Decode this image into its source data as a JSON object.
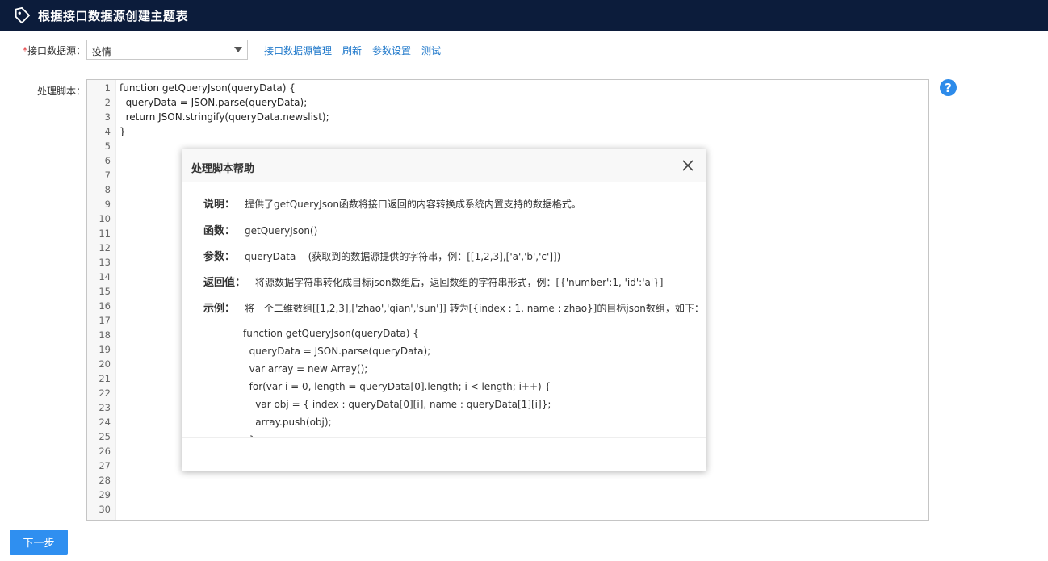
{
  "header": {
    "title": "根据接口数据源创建主题表",
    "icon": "tag-icon"
  },
  "form": {
    "datasource_required_mark": "*",
    "datasource_label": "接口数据源：",
    "datasource_value": "疫情",
    "links": [
      "接口数据源管理",
      "刷新",
      "参数设置",
      "测试"
    ],
    "script_label": "处理脚本："
  },
  "editor": {
    "line_numbers": [
      "1",
      "2",
      "3",
      "4",
      "5",
      "6",
      "7",
      "8",
      "9",
      "10",
      "11",
      "12",
      "13",
      "14",
      "15",
      "16",
      "17",
      "18",
      "19",
      "20",
      "21",
      "22",
      "23",
      "24",
      "25",
      "26",
      "27",
      "28",
      "29",
      "30"
    ],
    "code_lines": [
      "function getQueryJson(queryData) {",
      "  queryData = JSON.parse(queryData);",
      "  return JSON.stringify(queryData.newslist);",
      "}"
    ]
  },
  "help_icon_glyph": "?",
  "dialog": {
    "title": "处理脚本帮助",
    "rows": [
      {
        "key": "说明：",
        "value": "提供了getQueryJson函数将接口返回的内容转换成系统内置支持的数据格式。"
      },
      {
        "key": "函数：",
        "value": "getQueryJson()"
      },
      {
        "key": "参数：",
        "value": "queryData    (获取到的数据源提供的字符串，例：[[1,2,3],['a','b','c']])"
      },
      {
        "key": "返回值：",
        "value": "将源数据字符串转化成目标json数组后，返回数组的字符串形式，例：[{'number':1, 'id':'a'}]"
      },
      {
        "key": "示例：",
        "value": "将一个二维数组[[1,2,3],['zhao','qian','sun']] 转为[{index : 1, name : zhao}]的目标json数组，如下："
      }
    ],
    "example_code": [
      "function getQueryJson(queryData) {",
      "  queryData = JSON.parse(queryData);",
      "  var array = new Array();",
      "  for(var i = 0, length = queryData[0].length; i < length; i++) {",
      "    var obj = { index : queryData[0][i], name : queryData[1][i]};",
      "    array.push(obj);",
      "  }"
    ]
  },
  "buttons": {
    "next": "下一步"
  },
  "colors": {
    "header_bg": "#0c1c3b",
    "link": "#1a75c9",
    "primary": "#2f8ff0",
    "help": "#2d8bea",
    "required": "#e4393c"
  }
}
